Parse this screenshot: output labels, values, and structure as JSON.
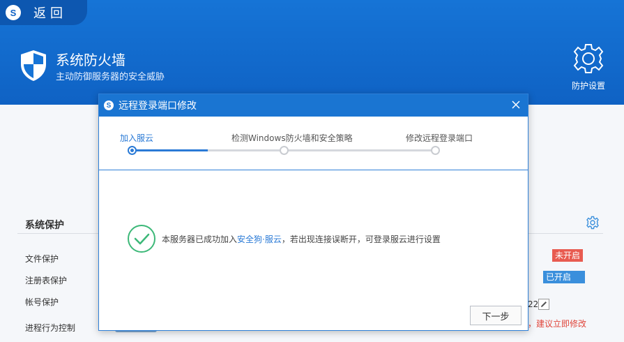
{
  "header": {
    "back_label": "返回",
    "logo_glyph": "S",
    "title": "系统防火墙",
    "subtitle": "主动防御服务器的安全威胁",
    "settings_label": "防护设置"
  },
  "background": {
    "section_title": "系统保护",
    "rows": [
      {
        "label": "文件保护"
      },
      {
        "label": "注册表保护"
      },
      {
        "label": "帐号保护"
      },
      {
        "label": "进程行为控制"
      }
    ],
    "status_off": "未开启",
    "status_on": "已开启",
    "port_fragment": "22",
    "warning_fragment": "，建议立即修改"
  },
  "dialog": {
    "logo_glyph": "S",
    "title": "远程登录端口修改",
    "steps": [
      {
        "label": "加入服云",
        "active": true
      },
      {
        "label": "检测Windows防火墙和安全策略",
        "active": false
      },
      {
        "label": "修改远程登录端口",
        "active": false
      }
    ],
    "progress_fraction": 0.25,
    "message_prefix": "本服务器已成功加入",
    "message_link": "安全狗·服云",
    "message_suffix": "，若出现连接误断开，可登录服云进行设置",
    "next_label": "下一步"
  },
  "colors": {
    "header_blue": "#1674d6",
    "accent_blue": "#2a7ad6",
    "success_green": "#3cb878",
    "status_off_red": "#e85b50",
    "status_on_blue": "#3a8fdc"
  }
}
